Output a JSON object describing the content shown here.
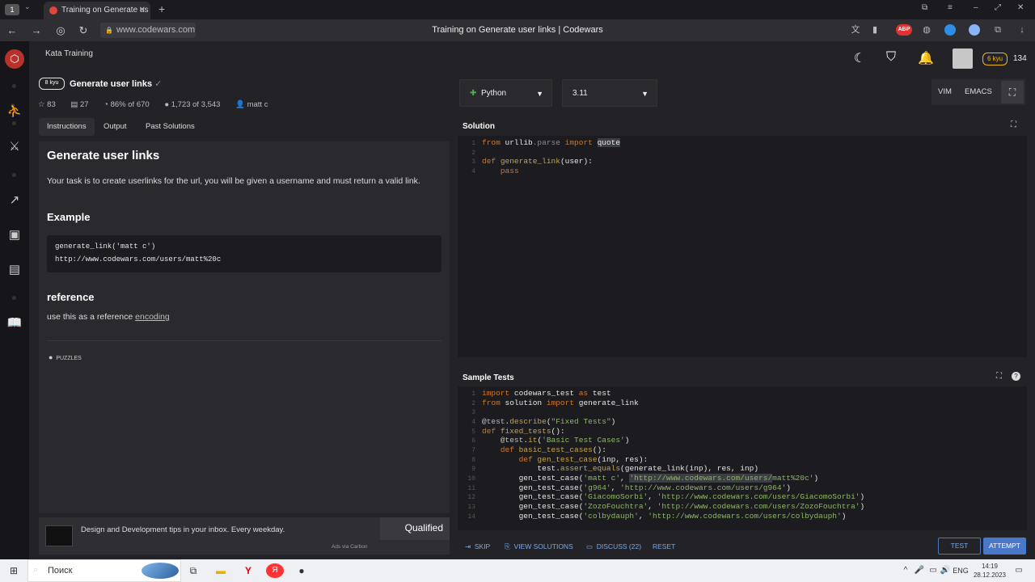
{
  "browser": {
    "tab_title": "Training on Generate us",
    "url": "www.codewars.com",
    "page_title": "Training on Generate user links | Codewars",
    "tab_counter": "1",
    "ext_abp": "ABP"
  },
  "app": {
    "section": "Kata Training",
    "rank_badge": "6 kyu",
    "honor": "134"
  },
  "kata": {
    "kyu": "8 kyu",
    "title": "Generate user links",
    "stats": {
      "stars": "83",
      "collections": "27",
      "satisfaction": "86% of 670",
      "completed": "1,723 of 3,543",
      "author": "matt c"
    },
    "tabs": [
      "Instructions",
      "Output",
      "Past Solutions"
    ],
    "heading": "Generate user links",
    "intro": "Your task is to create userlinks for the url, you will be given a username and must return a valid link.",
    "example_heading": "Example",
    "example_line1": "generate_link('matt c')",
    "example_line2": "http://www.codewars.com/users/matt%20c",
    "reference_heading": "reference",
    "reference_text": "use this as a reference",
    "reference_link": "encoding",
    "tag": "PUZZLES",
    "ad_text": "Design and Development tips in your inbox. Every weekday.",
    "ad_brand": "Qualified",
    "ad_via": "Ads via Carbon"
  },
  "editor": {
    "language": "Python",
    "version": "3.11",
    "modes": [
      "VIM",
      "EMACS"
    ],
    "solution_label": "Solution",
    "tests_label": "Sample Tests"
  },
  "actions": {
    "skip": "SKIP",
    "view_solutions": "VIEW SOLUTIONS",
    "discuss": "DISCUSS (22)",
    "reset": "RESET",
    "test": "TEST",
    "attempt": "ATTEMPT"
  },
  "taskbar": {
    "search": "Поиск",
    "lang": "ENG",
    "time": "14:19",
    "date": "28.12.2023"
  },
  "colors": {
    "accent": "#4a78c8",
    "rank": "#ecb613",
    "brand": "#e0463a"
  }
}
